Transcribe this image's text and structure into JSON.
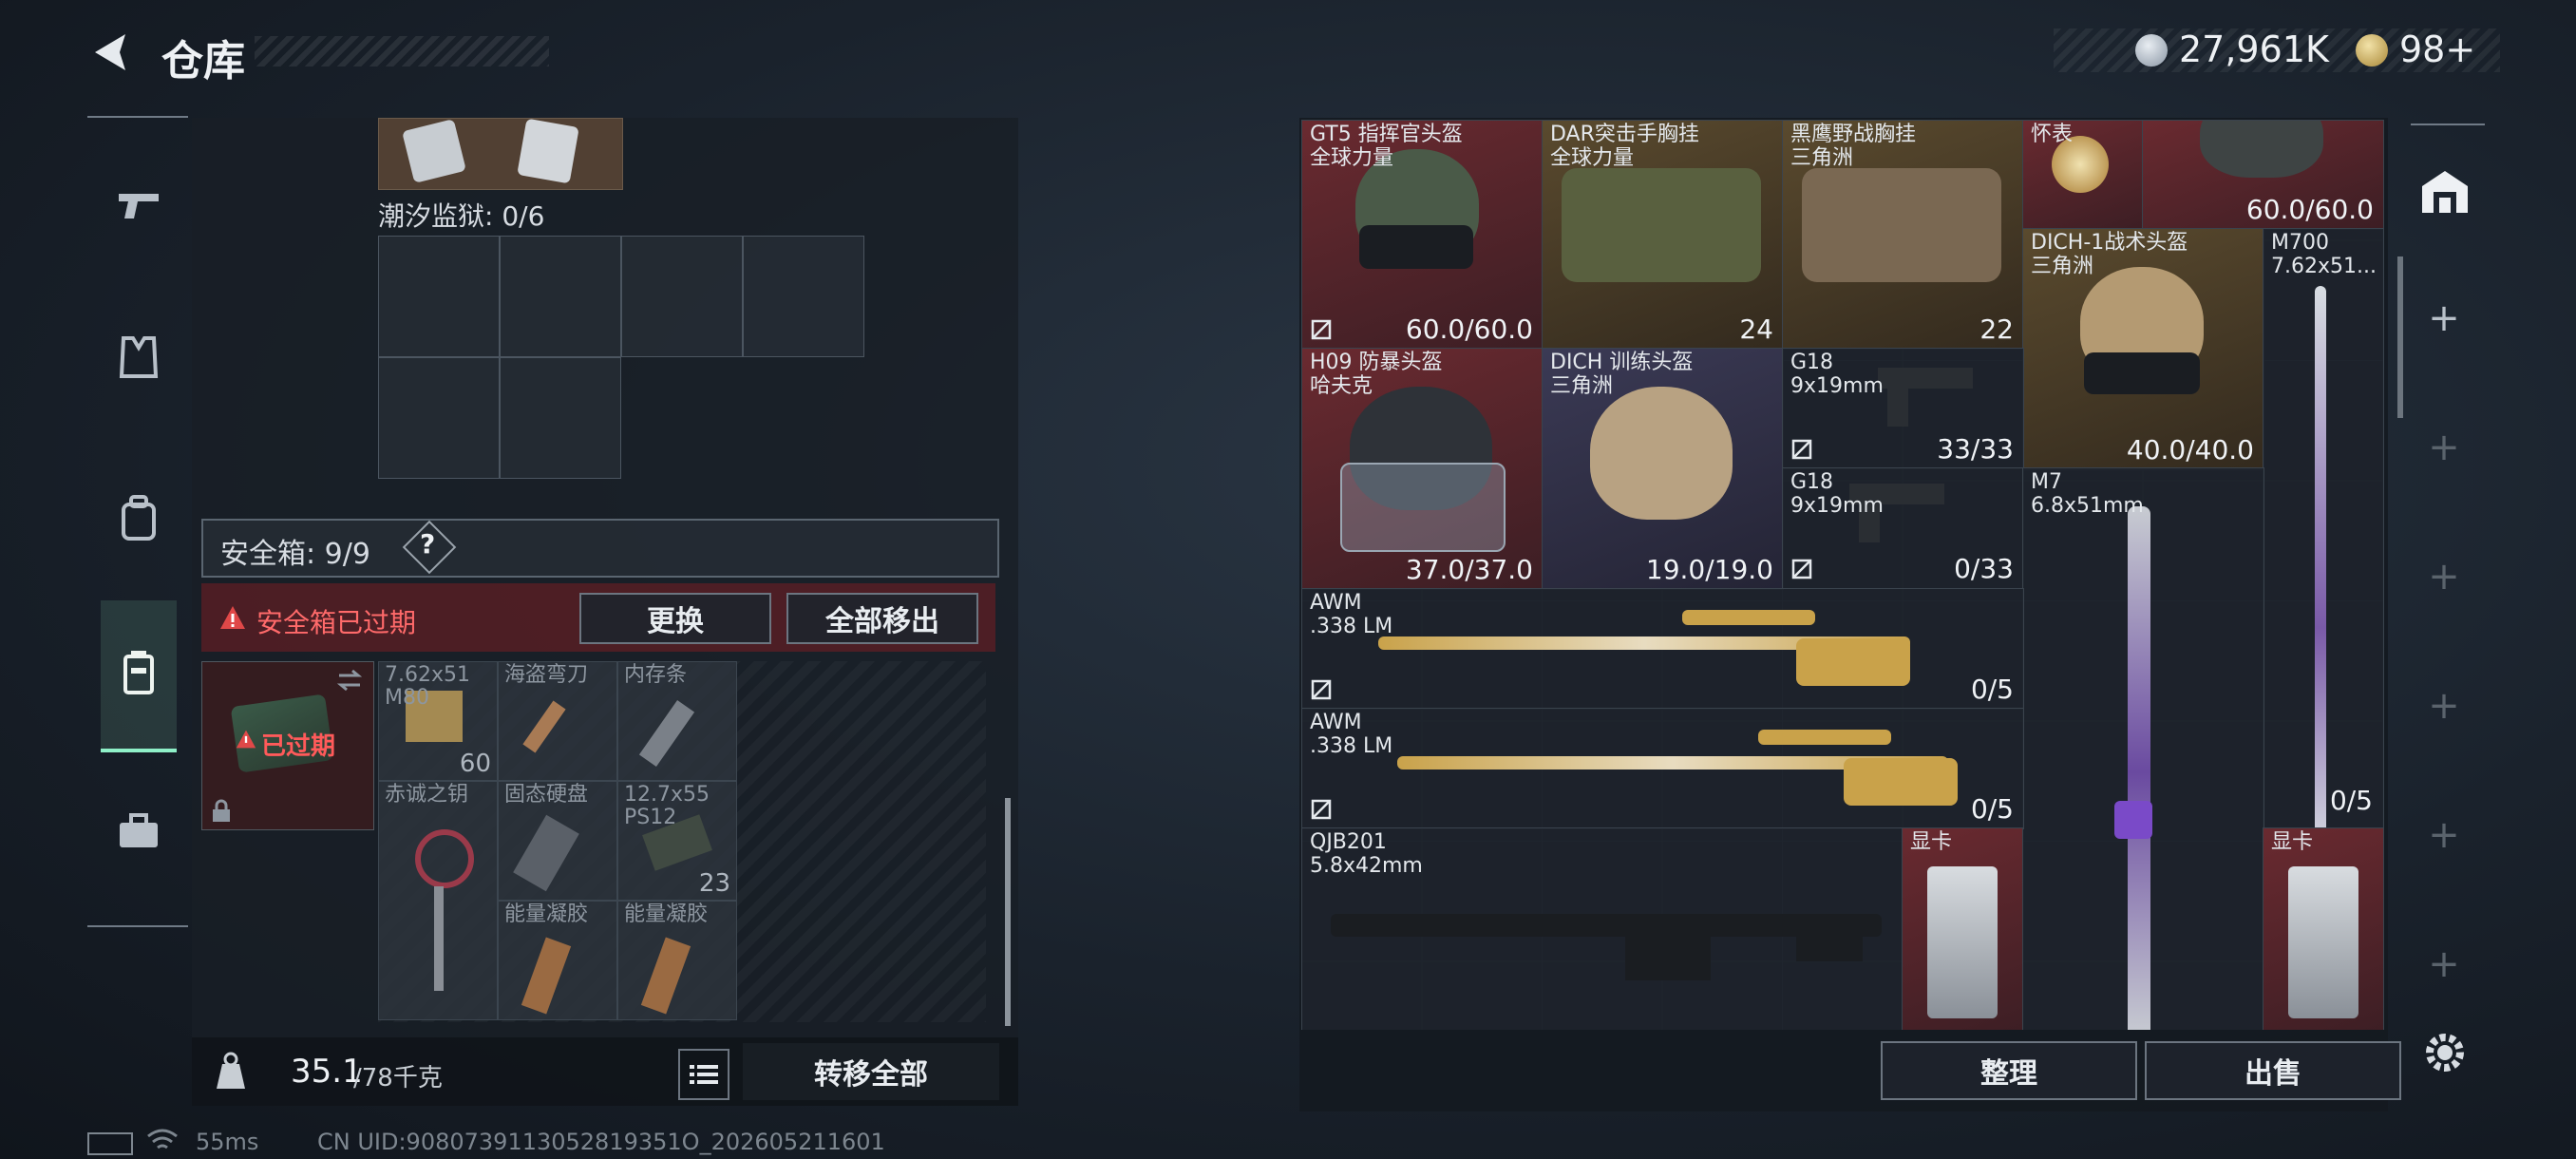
{
  "header": {
    "title": "仓库",
    "currency_main": "27,961K",
    "currency_secondary": "98+"
  },
  "left_panel": {
    "top_items": [
      "",
      ""
    ],
    "tidal_prison_label": "潮汐监狱: 0/6",
    "safe_box_label": "安全箱: 9/9",
    "help_symbol": "?",
    "expired_warning": "安全箱已过期",
    "replace_button": "更换",
    "remove_all_button": "全部移出",
    "case_status": "已过期",
    "items": [
      {
        "label": "7.62x51\nM80",
        "count": "60"
      },
      {
        "label": "海盗弯刀",
        "count": ""
      },
      {
        "label": "内存条",
        "count": ""
      },
      {
        "label": "赤诚之钥",
        "count": ""
      },
      {
        "label": "固态硬盘",
        "count": ""
      },
      {
        "label": "12.7x55\nPS12",
        "count": "23"
      },
      {
        "label": "",
        "count": ""
      },
      {
        "label": "能量凝胶",
        "count": ""
      },
      {
        "label": "能量凝胶",
        "count": ""
      }
    ],
    "weight_value": "35.1",
    "weight_max": "/78千克",
    "transfer_all_button": "转移全部"
  },
  "stash": {
    "items": [
      {
        "name": "GT5 指挥官头盔\n全球力量",
        "value": "60.0/60.0"
      },
      {
        "name": "DAR突击手胸挂\n全球力量",
        "value": "24"
      },
      {
        "name": "黑鹰野战胸挂\n三角洲",
        "value": "22"
      },
      {
        "name": "怀表",
        "value": ""
      },
      {
        "name": "",
        "value": "60.0/60.0"
      },
      {
        "name": "DICH-1战术头盔\n三角洲",
        "value": "40.0/40.0"
      },
      {
        "name": "M700\n7.62x51...",
        "value": "0/5"
      },
      {
        "name": "H09 防暴头盔\n哈夫克",
        "value": "37.0/37.0"
      },
      {
        "name": "DICH 训练头盔\n三角洲",
        "value": "19.0/19.0"
      },
      {
        "name": "G18\n9x19mm",
        "value": "33/33"
      },
      {
        "name": "G18\n9x19mm",
        "value": "0/33"
      },
      {
        "name": "M7\n6.8x51mm",
        "value": ""
      },
      {
        "name": "AWM\n.338 LM",
        "value": "0/5"
      },
      {
        "name": "AWM\n.338 LM",
        "value": "0/5"
      },
      {
        "name": "QJB201\n5.8x42mm",
        "value": ""
      },
      {
        "name": "显卡",
        "value": ""
      },
      {
        "name": "显卡",
        "value": ""
      }
    ],
    "sort_button": "整理",
    "sell_button": "出售"
  },
  "status_bar": {
    "ping": "55ms",
    "uid": "CN UID:9080739113052819351O_202605211601"
  },
  "colors": {
    "accent_green": "#8ff0c8",
    "warning_red": "#e04848",
    "gold": "#c9a24a"
  },
  "icons": [
    "back-icon",
    "coin-icon",
    "gold-coin-icon",
    "gun-icon",
    "vest-icon",
    "backpack-icon",
    "safe-box-icon",
    "briefcase-icon",
    "lock-icon",
    "warning-icon",
    "list-icon",
    "weight-icon",
    "settings-icon",
    "storage-icon",
    "plus-icon",
    "swap-icon"
  ]
}
